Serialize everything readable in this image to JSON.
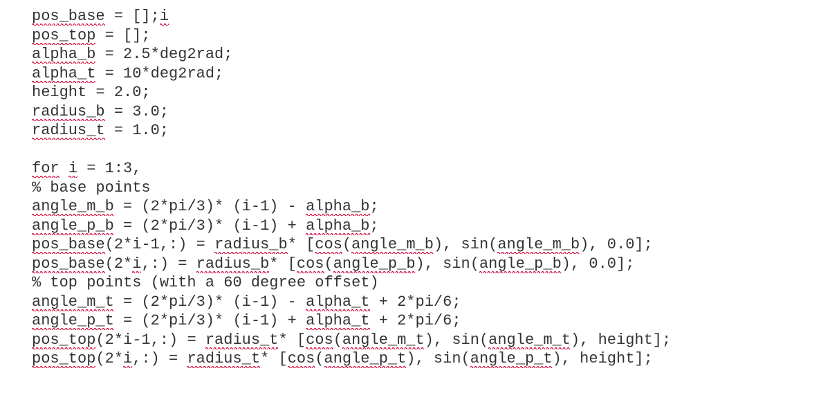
{
  "code": {
    "lines": [
      [
        {
          "t": "pos_base",
          "sq": true
        },
        {
          "t": " = [];"
        },
        {
          "t": "i",
          "sq": true
        }
      ],
      [
        {
          "t": "pos_top",
          "sq": true
        },
        {
          "t": " = [];"
        }
      ],
      [
        {
          "t": "alpha_b",
          "sq": true
        },
        {
          "t": " = 2.5*deg2rad;"
        }
      ],
      [
        {
          "t": "alpha_t",
          "sq": true
        },
        {
          "t": " = 10*deg2rad;"
        }
      ],
      [
        {
          "t": "height = 2.0;"
        }
      ],
      [
        {
          "t": "radius_b",
          "sq": true
        },
        {
          "t": " = 3.0;"
        }
      ],
      [
        {
          "t": "radius_t",
          "sq": true
        },
        {
          "t": " = 1.0;"
        }
      ],
      [
        {
          "t": ""
        }
      ],
      [
        {
          "t": "for",
          "sq": true
        },
        {
          "t": " "
        },
        {
          "t": "i",
          "sq": true
        },
        {
          "t": " = 1:3,"
        }
      ],
      [
        {
          "t": "% base points"
        }
      ],
      [
        {
          "t": "angle_m_b",
          "sq": true
        },
        {
          "t": " = (2*pi/3)* (i-1) - "
        },
        {
          "t": "alpha_b",
          "sq": true
        },
        {
          "t": ";"
        }
      ],
      [
        {
          "t": "angle_p_b",
          "sq": true
        },
        {
          "t": " = (2*pi/3)* (i-1) + "
        },
        {
          "t": "alpha_b",
          "sq": true
        },
        {
          "t": ";"
        }
      ],
      [
        {
          "t": "pos_base",
          "sq": true
        },
        {
          "t": "(2*i-1,:) = "
        },
        {
          "t": "radius_b",
          "sq": true
        },
        {
          "t": "* ["
        },
        {
          "t": "cos",
          "sq": true
        },
        {
          "t": "("
        },
        {
          "t": "angle_m_b",
          "sq": true
        },
        {
          "t": "), sin("
        },
        {
          "t": "angle_m_b",
          "sq": true
        },
        {
          "t": "), 0.0];"
        }
      ],
      [
        {
          "t": "pos_base",
          "sq": true
        },
        {
          "t": "(2*"
        },
        {
          "t": "i",
          "sq": true
        },
        {
          "t": ",:) = "
        },
        {
          "t": "radius_b",
          "sq": true
        },
        {
          "t": "* ["
        },
        {
          "t": "cos",
          "sq": true
        },
        {
          "t": "("
        },
        {
          "t": "angle_p_b",
          "sq": true
        },
        {
          "t": "), sin("
        },
        {
          "t": "angle_p_b",
          "sq": true
        },
        {
          "t": "), 0.0];"
        }
      ],
      [
        {
          "t": "% top points (with a 60 degree offset)"
        }
      ],
      [
        {
          "t": "angle_m_t",
          "sq": true
        },
        {
          "t": " = (2*pi/3)* (i-1) - "
        },
        {
          "t": "alpha_t",
          "sq": true
        },
        {
          "t": " + 2*pi/6;"
        }
      ],
      [
        {
          "t": "angle_p_t",
          "sq": true
        },
        {
          "t": " = (2*pi/3)* (i-1) + "
        },
        {
          "t": "alpha_t",
          "sq": true
        },
        {
          "t": " + 2*pi/6;"
        }
      ],
      [
        {
          "t": "pos_top",
          "sq": true
        },
        {
          "t": "(2*i-1,:) = "
        },
        {
          "t": "radius_t",
          "sq": true
        },
        {
          "t": "* ["
        },
        {
          "t": "cos",
          "sq": true
        },
        {
          "t": "("
        },
        {
          "t": "angle_m_t",
          "sq": true
        },
        {
          "t": "), sin("
        },
        {
          "t": "angle_m_t",
          "sq": true
        },
        {
          "t": "), height];"
        }
      ],
      [
        {
          "t": "pos_top",
          "sq": true
        },
        {
          "t": "(2*"
        },
        {
          "t": "i",
          "sq": true
        },
        {
          "t": ",:) = "
        },
        {
          "t": "radius_t",
          "sq": true
        },
        {
          "t": "* ["
        },
        {
          "t": "cos",
          "sq": true
        },
        {
          "t": "("
        },
        {
          "t": "angle_p_t",
          "sq": true
        },
        {
          "t": "), sin("
        },
        {
          "t": "angle_p_t",
          "sq": true
        },
        {
          "t": "), height];"
        }
      ]
    ]
  }
}
